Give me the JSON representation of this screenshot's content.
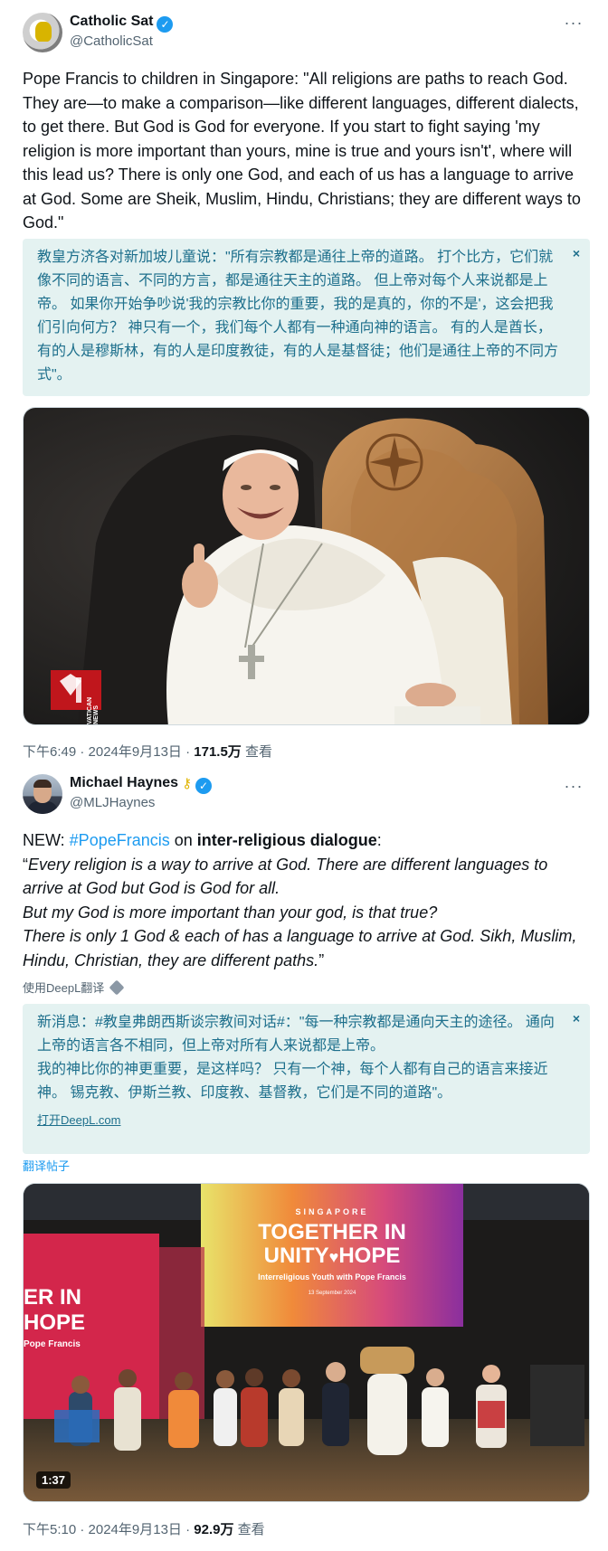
{
  "tweet1": {
    "display_name": "Catholic Sat",
    "handle": "@CatholicSat",
    "text": "Pope Francis to children in Singapore: \"All religions are paths to reach God. They are—to make a comparison—like different languages, different dialects, to get there. But God is God for everyone. If you start to fight saying 'my religion is more important than yours, mine is true and yours isn't', where will this lead us? There is only one God, and each of us has a language to arrive at God. Some are Sheik, Muslim, Hindu, Christians; they are different ways to God.\"",
    "translation": "教皇方济各对新加坡儿童说：\"所有宗教都是通往上帝的道路。 打个比方，它们就像不同的语言、不同的方言，都是通往天主的道路。 但上帝对每个人来说都是上帝。 如果你开始争吵说'我的宗教比你的重要，我的是真的，你的不是'，这会把我们引向何方？ 神只有一个，我们每个人都有一种通向神的语言。 有的人是酋长，有的人是穆斯林，有的人是印度教徒，有的人是基督徒；他们是通往上帝的不同方式\"。",
    "close": "×",
    "image_badge": "VATICAN NEWS",
    "time": "下午6:49 · 2024年9月13日 · ",
    "views": "171.5万",
    "views_label": " 查看"
  },
  "tweet2": {
    "display_name": "Michael Haynes",
    "handle": "@MLJHaynes",
    "lead_prefix": "NEW: ",
    "hashtag": "#PopeFrancis",
    "lead_mid": " on ",
    "lead_bold": "inter-religious dialogue",
    "lead_suffix": ":",
    "quote_open": "“",
    "quote_lines": [
      "Every religion is a way to arrive at God. There are different languages to arrive at God but God is God for all.",
      "But my God is more important than your god, is that true?",
      "There is only 1 God & each of has a language to arrive at God. Sikh, Muslim, Hindu, Christian, they are different paths."
    ],
    "quote_close": "”",
    "deepl_note": "使用DeepL翻译",
    "translation_lines": [
      "新消息：#教皇弗朗西斯谈宗教间对话#：\"每一种宗教都是通向天主的途径。 通向上帝的语言各不相同，但上帝对所有人来说都是上帝。",
      "我的神比你的神更重要，是这样吗？ 只有一个神，每个人都有自己的语言来接近神。 锡克教、伊斯兰教、印度教、基督教，它们是不同的道路\"。"
    ],
    "open_deepl": "打开DeepL.com",
    "close": "×",
    "translate_post": "翻译帖子",
    "video_duration": "1:37",
    "banner": {
      "top": "SINGAPORE",
      "line1": "TOGETHER IN",
      "line2": "UNITY",
      "line2b": "HOPE",
      "sub": "Interreligious Youth with Pope Francis",
      "date": "13 September 2024"
    },
    "side_banner": [
      "ER IN",
      "HOPE",
      "Pope Francis"
    ],
    "time": "下午5:10 · 2024年9月13日 · ",
    "views": "92.9万",
    "views_label": " 查看"
  },
  "colors": {
    "link": "#1d9bf0",
    "translation_bg": "#e4f2f1",
    "translation_text": "#1d6f8c",
    "muted": "#536471"
  }
}
